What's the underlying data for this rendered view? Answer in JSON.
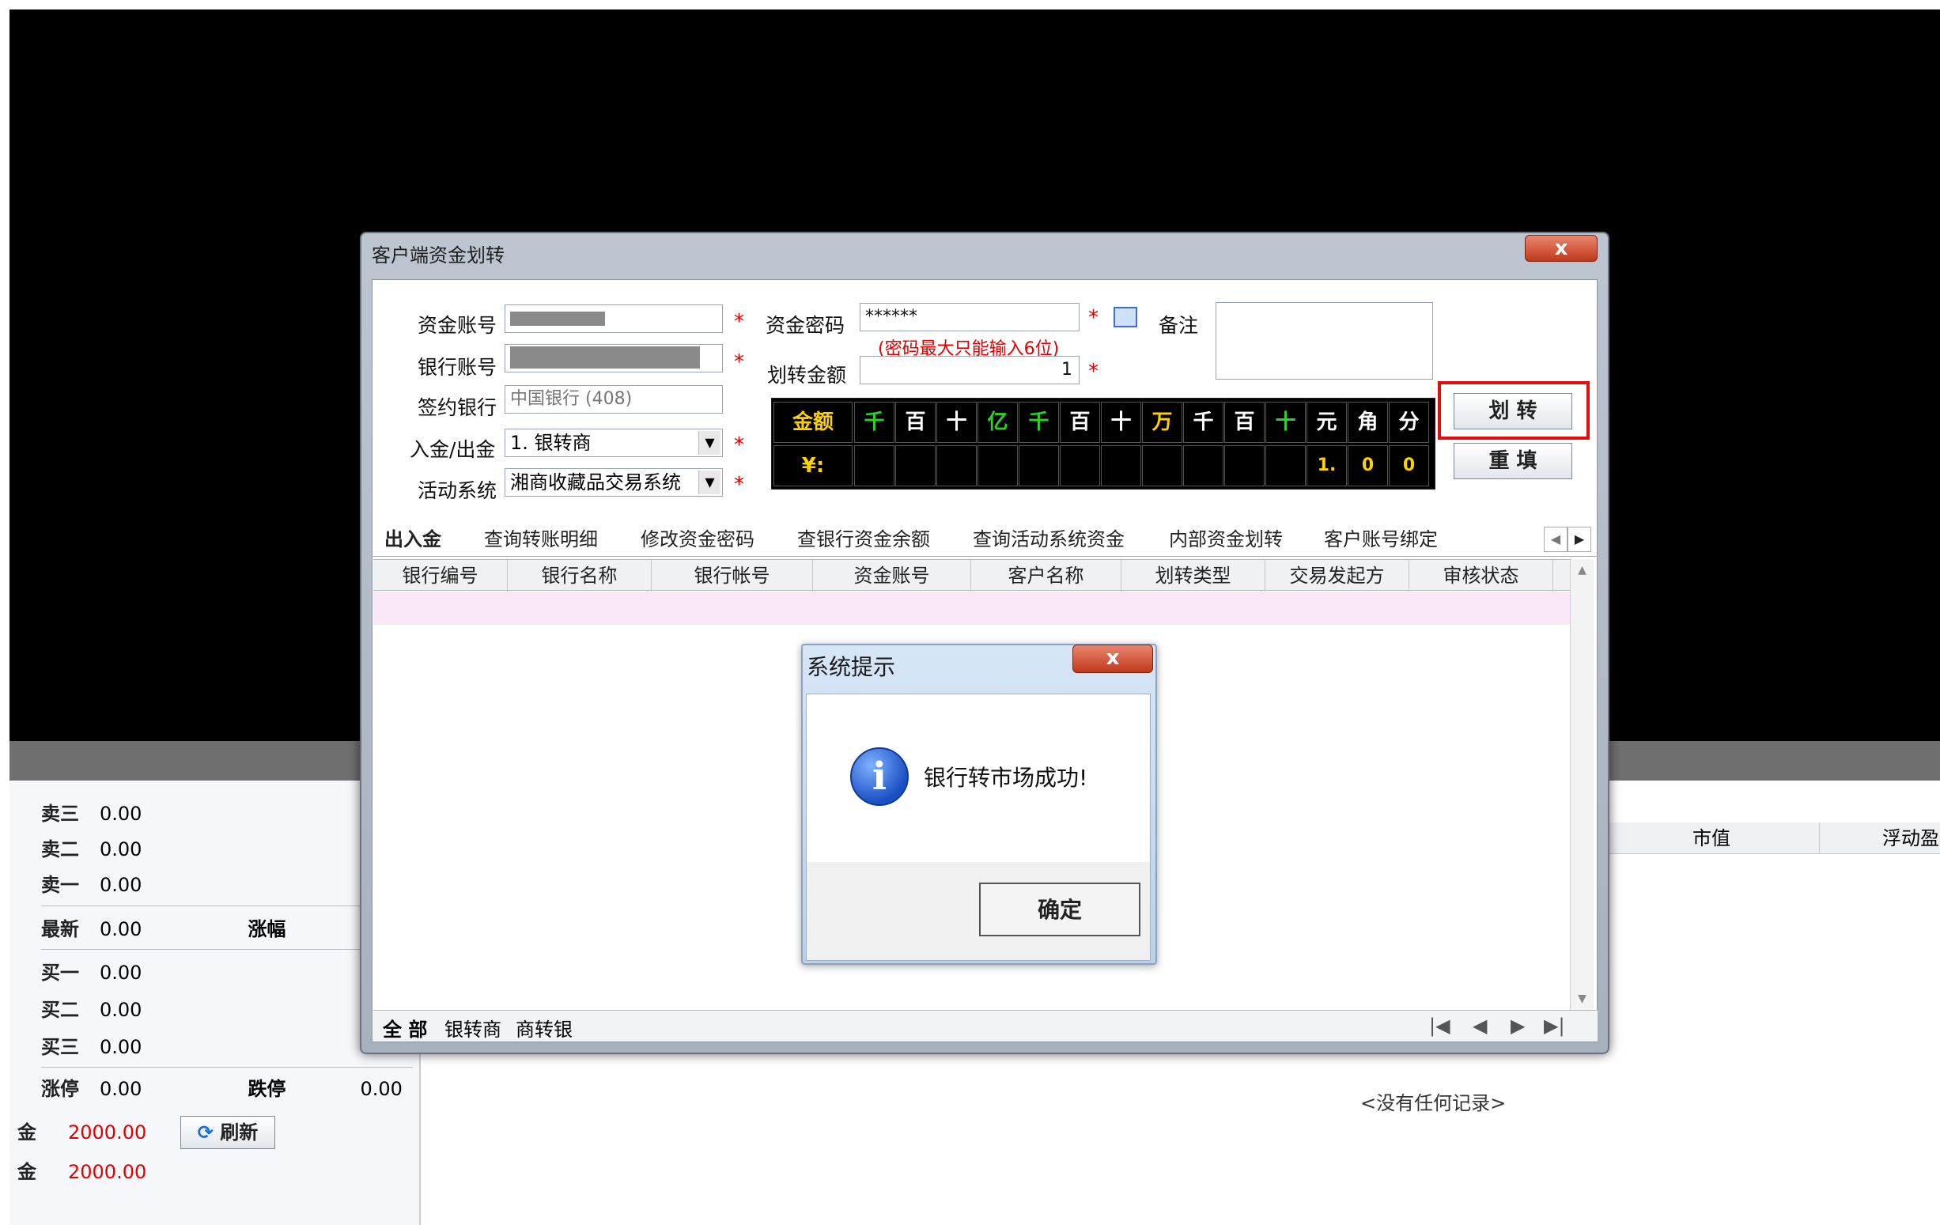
{
  "background": {
    "quote_rows": [
      {
        "label": "卖三",
        "value": "0.00"
      },
      {
        "label": "卖二",
        "value": "0.00"
      },
      {
        "label": "卖一",
        "value": "0.00"
      },
      {
        "label": "最新",
        "value": "0.00",
        "label2": "涨幅"
      },
      {
        "label": "买一",
        "value": "0.00"
      },
      {
        "label": "买二",
        "value": "0.00"
      },
      {
        "label": "买三",
        "value": "0.00"
      },
      {
        "label": "涨停",
        "value": "0.00",
        "label2": "跌停",
        "value2": "0.00"
      }
    ],
    "fund_rows": [
      {
        "label": "金",
        "value": "2000.00"
      },
      {
        "label": "金",
        "value": "2000.00"
      }
    ],
    "refresh_label": "刷新",
    "col_market_value": "市值",
    "col_floating_pl": "浮动盈",
    "no_records": "<没有任何记录>"
  },
  "window": {
    "title": "客户端资金划转",
    "close_label": "x",
    "form": {
      "fund_account_label": "资金账号",
      "bank_account_label": "银行账号",
      "signed_bank_label": "签约银行",
      "signed_bank_value": "中国银行 (408)",
      "in_out_label": "入金/出金",
      "in_out_value": "1. 银转商",
      "active_system_label": "活动系统",
      "active_system_value": "湘商收藏品交易系统",
      "fund_password_label": "资金密码",
      "fund_password_value": "******",
      "password_hint": "(密码最大只能输入6位)",
      "transfer_amount_label": "划转金额",
      "transfer_amount_value": "1",
      "remark_label": "备注",
      "required_mark": "*"
    },
    "amount_grid": {
      "header": [
        "金额",
        "千",
        "百",
        "十",
        "亿",
        "千",
        "百",
        "十",
        "万",
        "千",
        "百",
        "十",
        "元",
        "角",
        "分"
      ],
      "currency_symbol": "¥:",
      "digits": [
        "1.",
        "0",
        "0"
      ]
    },
    "buttons": {
      "transfer": "划  转",
      "reset": "重  填"
    },
    "tabs": [
      "出入金",
      "查询转账明细",
      "修改资金密码",
      "查银行资金余额",
      "查询活动系统资金",
      "内部资金划转",
      "客户账号绑定"
    ],
    "grid_headers": [
      "银行编号",
      "银行名称",
      "银行帐号",
      "资金账号",
      "客户名称",
      "划转类型",
      "交易发起方",
      "审核状态"
    ],
    "bottom_tabs": [
      "全 部",
      "银转商",
      "商转银"
    ]
  },
  "dialog": {
    "title": "系统提示",
    "close_label": "x",
    "message": "银行转市场成功!",
    "ok_label": "确定"
  }
}
